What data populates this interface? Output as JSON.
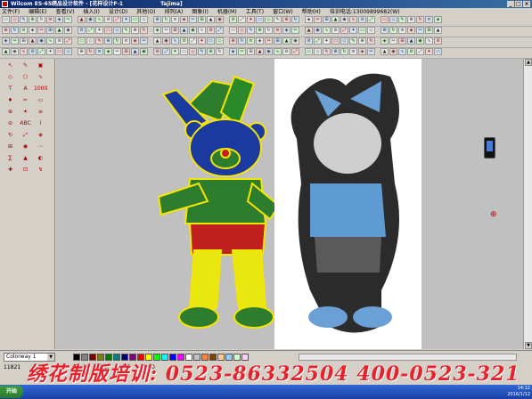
{
  "window": {
    "title": "Wilcom ES-65绣品设计软件 - [花样设计F-1",
    "title_suffix": "Tajima]"
  },
  "menu": [
    "文件(F)",
    "编辑(E)",
    "查看(V)",
    "插入(I)",
    "设计(D)",
    "其他(O)",
    "排列(A)",
    "图象(I)",
    "机器(M)",
    "工具(T)",
    "窗口(W)",
    "帮助(H)",
    "培训电话:13009899682(W)"
  ],
  "status": {
    "colorway": "Colorway 1",
    "stitch_count": "11821",
    "field2": "L-22",
    "field3": "3.2",
    "field4": "L-1",
    "field5": "包针",
    "field6": "1.5",
    "field7": "1.00"
  },
  "palette": [
    "#000000",
    "#808080",
    "#800000",
    "#808000",
    "#008000",
    "#008080",
    "#000080",
    "#800080",
    "#ff0000",
    "#ffff00",
    "#00ff00",
    "#00ffff",
    "#0000ff",
    "#ff00ff",
    "#ffffff",
    "#c0c0c0",
    "#ff8040",
    "#804000",
    "#ffcc99",
    "#99ccff",
    "#ccffcc",
    "#ffccff"
  ],
  "watermark": "绣花制版培训: 0523-86332504 400-0523-321",
  "taskbar": {
    "start": "开始",
    "time": "14:12",
    "date": "2016/1/12"
  },
  "left_tools": [
    "↖",
    "✎",
    "▣",
    "◇",
    "⬡",
    "∿",
    "T",
    "A",
    "1000",
    "♦",
    "✂",
    "▭",
    "⊕",
    "✦",
    "≡",
    "⊘",
    "ABC",
    "⌇",
    "↻",
    "⤢",
    "◈",
    "⊞",
    "◉",
    "⋯",
    "∑",
    "▲",
    "◐",
    "✚",
    "⊡",
    "↯"
  ]
}
